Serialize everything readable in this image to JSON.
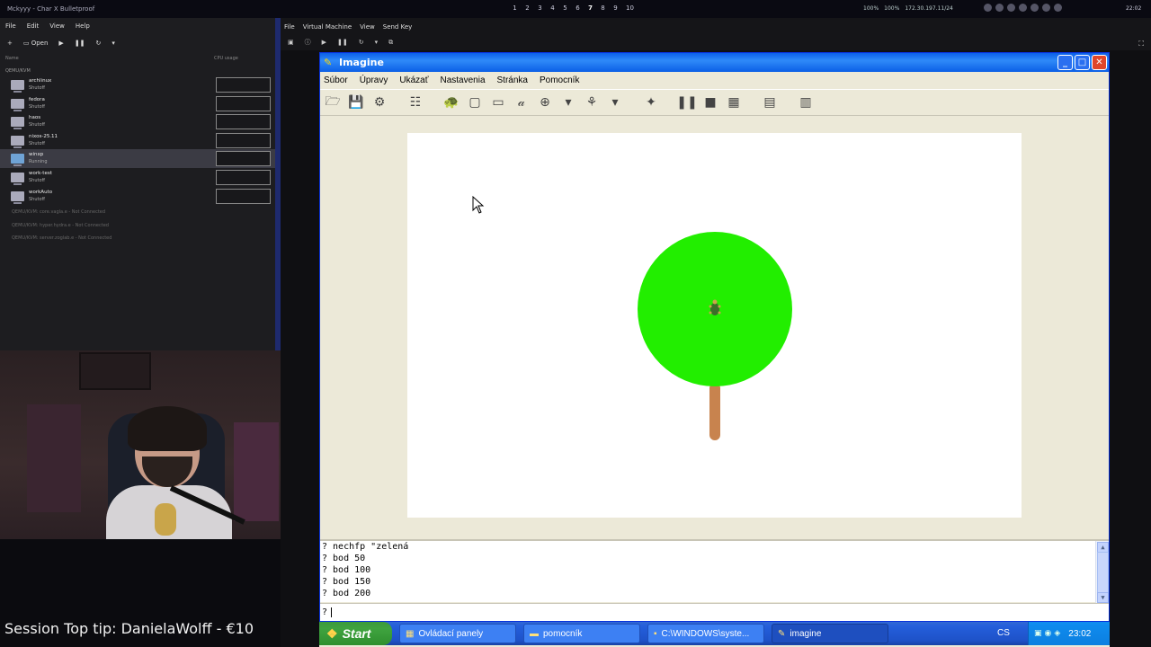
{
  "host": {
    "window_title": "Mckyyy - Char X Bulletproof",
    "workspaces": [
      "1",
      "2",
      "3",
      "4",
      "5",
      "6",
      "7",
      "8",
      "9",
      "10"
    ],
    "active_workspace": "7",
    "tray": [
      "100%",
      "100%",
      "172.30.197.11/24"
    ],
    "clock": "22:02"
  },
  "vmm": {
    "menu": [
      "File",
      "Edit",
      "View",
      "Help"
    ],
    "toolbar": {
      "new": "+",
      "open": "Open"
    },
    "col_name": "Name",
    "col_cpu": "CPU usage",
    "connection": "QEMU/KVM",
    "vms": [
      {
        "name": "archlinux",
        "state": "Shutoff"
      },
      {
        "name": "fedora",
        "state": "Shutoff"
      },
      {
        "name": "haos",
        "state": "Shutoff"
      },
      {
        "name": "nixos-25.11",
        "state": "Shutoff"
      },
      {
        "name": "winxp",
        "state": "Running"
      },
      {
        "name": "work-test",
        "state": "Shutoff"
      },
      {
        "name": "workAuto",
        "state": "Shutoff"
      }
    ],
    "disconnected": [
      "QEMU/KVM: core.vagla.e - Not Connected",
      "QEMU/KVM: hyper.hydra.e - Not Connected",
      "QEMU/KVM: server.zoglab.e - Not Connected"
    ]
  },
  "stream": {
    "tip": "Session Top tip: DanielaWolff - €10"
  },
  "viewer": {
    "menu": [
      "File",
      "Virtual Machine",
      "View",
      "Send Key"
    ]
  },
  "imagine": {
    "title": "Imagine",
    "menu": [
      "Súbor",
      "Úpravy",
      "Ukázať",
      "Nastavenia",
      "Stránka",
      "Pomocník"
    ],
    "console_lines": [
      "? nechfp \"zelená",
      "? bod 50",
      "? bod 100",
      "? bod 150",
      "? bod 200"
    ],
    "prompt": "?",
    "colors": {
      "crown": "#22ee00",
      "trunk": "#c8834e"
    }
  },
  "taskbar": {
    "start": "Start",
    "tasks": [
      "Ovládací panely",
      "pomocník",
      "C:\\WINDOWS\\syste...",
      "imagine"
    ],
    "active_task": "imagine",
    "lang": "CS",
    "clock": "23:02"
  }
}
